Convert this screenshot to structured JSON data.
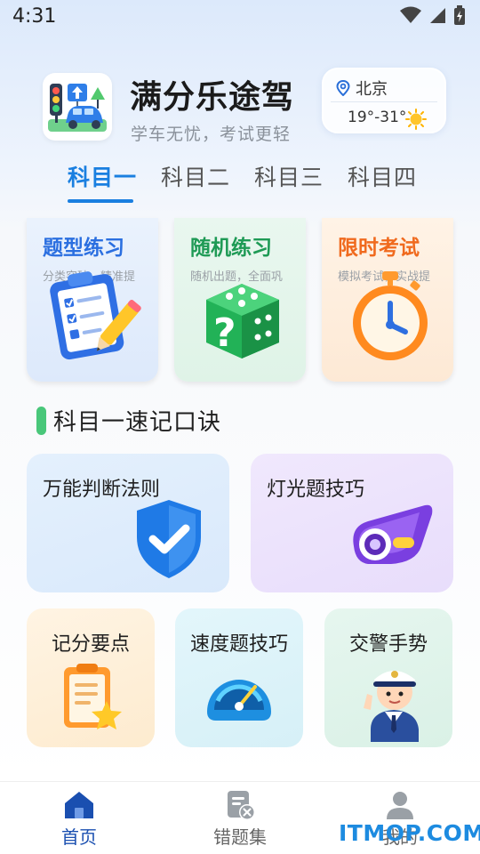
{
  "status_bar": {
    "time": "4:31",
    "icons": [
      "wifi-icon",
      "signal-icon",
      "battery-icon"
    ]
  },
  "header": {
    "app_name": "满分乐途驾",
    "slogan": "学车无忧，考试更轻",
    "logo_icon": "traffic-car-logo-icon"
  },
  "weather": {
    "city": "北京",
    "temperature": "19°-31°",
    "condition_icon": "sun-icon",
    "location_icon": "location-pin-icon"
  },
  "tabs": [
    {
      "label": "科目一",
      "active": true
    },
    {
      "label": "科目二",
      "active": false
    },
    {
      "label": "科目三",
      "active": false
    },
    {
      "label": "科目四",
      "active": false
    }
  ],
  "practice_cards": [
    {
      "title": "题型练习",
      "subtitle": "分类突破，精准提",
      "icon": "clipboard-checklist-icon",
      "color": "#2b6fe0"
    },
    {
      "title": "随机练习",
      "subtitle": "随机出题，全面巩",
      "icon": "question-dice-icon",
      "color": "#1e9a55"
    },
    {
      "title": "限时考试",
      "subtitle": "模拟考试，实战提",
      "icon": "stopwatch-icon",
      "color": "#f06a1e"
    }
  ],
  "section": {
    "title": "科目一速记口诀",
    "accent_color": "#49c77a"
  },
  "tip_cards": [
    {
      "label": "万能判断法则",
      "icon": "shield-check-icon"
    },
    {
      "label": "灯光题技巧",
      "icon": "headlight-icon"
    },
    {
      "label": "记分要点",
      "icon": "clipboard-star-icon"
    },
    {
      "label": "速度题技巧",
      "icon": "speedometer-icon"
    },
    {
      "label": "交警手势",
      "icon": "traffic-police-icon"
    }
  ],
  "bottom_nav": [
    {
      "label": "首页",
      "icon": "home-icon",
      "active": true
    },
    {
      "label": "错题集",
      "icon": "wrong-questions-icon",
      "active": false
    },
    {
      "label": "我的",
      "icon": "profile-icon",
      "active": false
    }
  ],
  "watermark": "ITMOP.COM",
  "colors": {
    "primary": "#1a7fe0",
    "active_nav": "#1a4fb0"
  }
}
